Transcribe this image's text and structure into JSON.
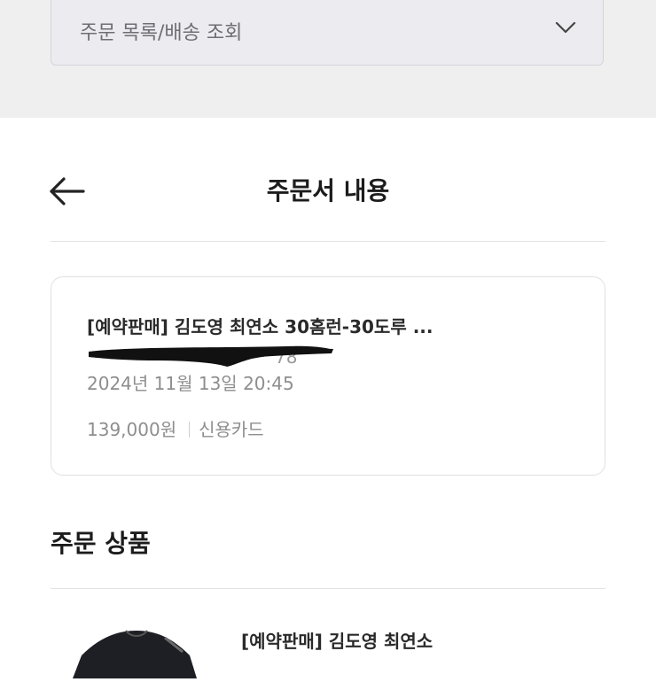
{
  "order_filter": {
    "selected": "주문 목록/배송 조회",
    "chevron_icon": "chevron-down-icon"
  },
  "header": {
    "title": "주문서 내용",
    "back_icon": "arrow-left-icon"
  },
  "order": {
    "title": "[예약판매] 김도영 최연소 30홈런-30도루 ...",
    "number": "78",
    "date": "2024년 11월 13일 20:45",
    "amount": "139,000원",
    "payment_method": "신용카드"
  },
  "order_items": {
    "section_title": "주문 상품",
    "items": [
      {
        "name": "[예약판매] 김도영 최연소"
      }
    ]
  }
}
